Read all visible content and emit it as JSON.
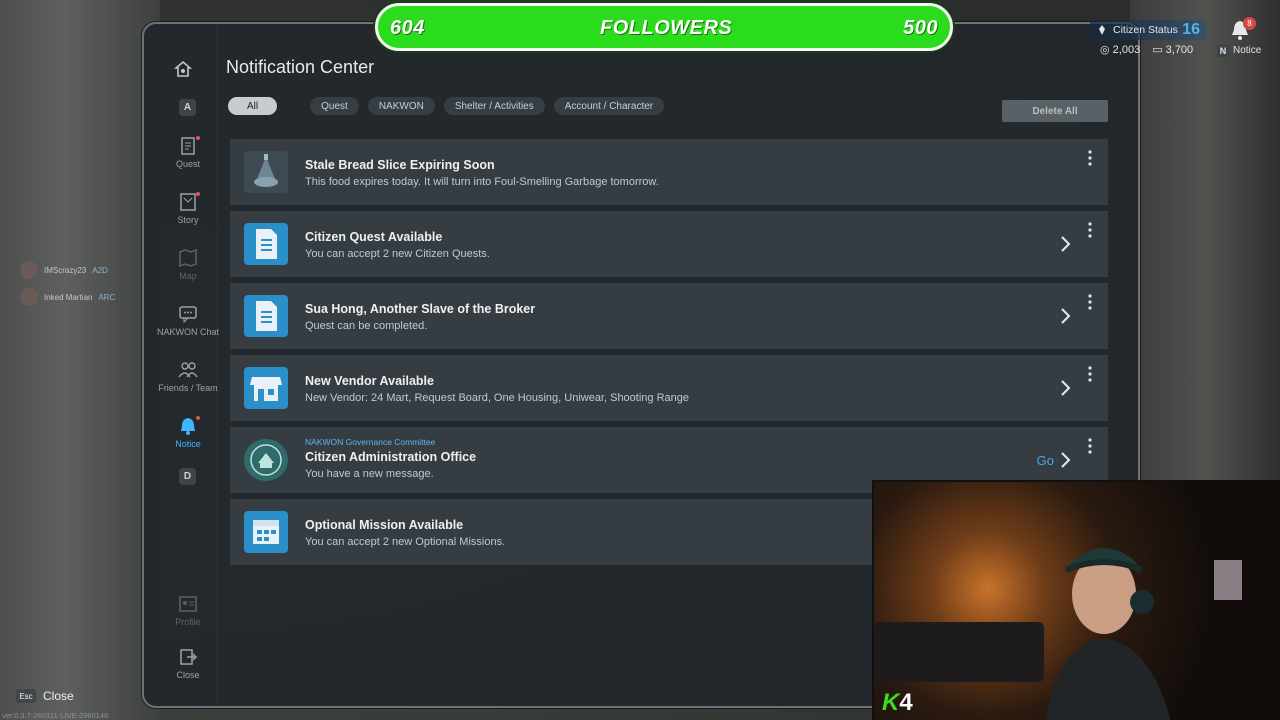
{
  "window": {
    "title": "Notification Center"
  },
  "followers_bar": {
    "left_value": "604",
    "label": "FOLLOWERS",
    "right_value": "500",
    "color": "#2bdc1c"
  },
  "hud": {
    "citizen_label": "Citizen Status",
    "citizen_level": "16",
    "currency_a": "2,003",
    "currency_b": "3,700",
    "notice_key": "N",
    "notice_label": "Notice",
    "badge_count": "8"
  },
  "sidebar": {
    "key_top": "A",
    "key_bottom": "D",
    "items": [
      {
        "label": "Quest",
        "icon": "quest-icon"
      },
      {
        "label": "Story",
        "icon": "story-icon"
      },
      {
        "label": "Map",
        "icon": "map-icon"
      },
      {
        "label": "NAKWON Chat",
        "icon": "chat-icon"
      },
      {
        "label": "Friends / Team",
        "icon": "friends-icon"
      },
      {
        "label": "Notice",
        "icon": "bell-icon"
      },
      {
        "label": "Profile",
        "icon": "profile-icon"
      },
      {
        "label": "Close",
        "icon": "exit-icon"
      }
    ]
  },
  "filters": [
    "All",
    "Quest",
    "NAKWON",
    "Shelter / Activities",
    "Account / Character"
  ],
  "delete_all_label": "Delete All",
  "notifications": [
    {
      "title": "Stale Bread Slice Expiring Soon",
      "desc": "This food expires today. It will turn into Foul-Smelling Garbage tomorrow.",
      "icon": "bread-icon"
    },
    {
      "title": "Citizen Quest Available",
      "desc": "You can accept 2 new Citizen Quests.",
      "icon": "document-icon"
    },
    {
      "title": "Sua Hong, Another Slave of the Broker",
      "desc": "Quest can be completed.",
      "icon": "document-icon"
    },
    {
      "title": "New Vendor Available",
      "desc": "New Vendor: 24 Mart, Request Board, One Housing, Uniwear, Shooting Range",
      "icon": "store-icon"
    },
    {
      "pre": "NAKWON Governance Committee",
      "title": "Citizen Administration Office",
      "desc": "You have a new message.",
      "action": "Go",
      "icon": "seal-icon"
    },
    {
      "title": "Optional Mission Available",
      "desc": "You can accept 2 new Optional Missions.",
      "icon": "calendar-icon"
    }
  ],
  "party": [
    {
      "name": "IMScrazy23",
      "tag": "A2D"
    },
    {
      "name": "Inked Martian",
      "tag": "ARC"
    }
  ],
  "footer": {
    "esc_key": "Esc",
    "esc_label": "Close",
    "version": "ver.0.3.7-260311-LIVE-2960148"
  },
  "overlay": {
    "logo_letter": "K",
    "logo_number": "4"
  }
}
